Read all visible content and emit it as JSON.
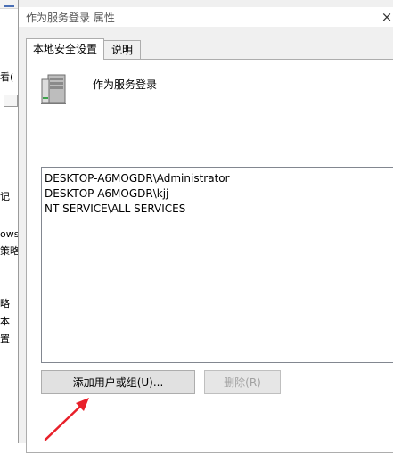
{
  "background_window": {
    "fragments": [
      "看(",
      "记",
      "ows",
      "策略",
      "略",
      "本",
      "置"
    ]
  },
  "dialog": {
    "title": "作为服务登录 属性",
    "close_glyph": "×",
    "tabs": [
      {
        "label": "本地安全设置",
        "active": true
      },
      {
        "label": "说明",
        "active": false
      }
    ],
    "policy_name": "作为服务登录",
    "policy_icon": "server-icon",
    "accounts": [
      "DESKTOP-A6MOGDR\\Administrator",
      "DESKTOP-A6MOGDR\\kjj",
      "NT SERVICE\\ALL SERVICES"
    ],
    "buttons": {
      "add_label": "添加用户或组(U)...",
      "remove_label": "删除(R)"
    }
  },
  "annotation": {
    "type": "red-arrow",
    "color": "#e8202a",
    "points_to": "add-user-or-group-button"
  }
}
